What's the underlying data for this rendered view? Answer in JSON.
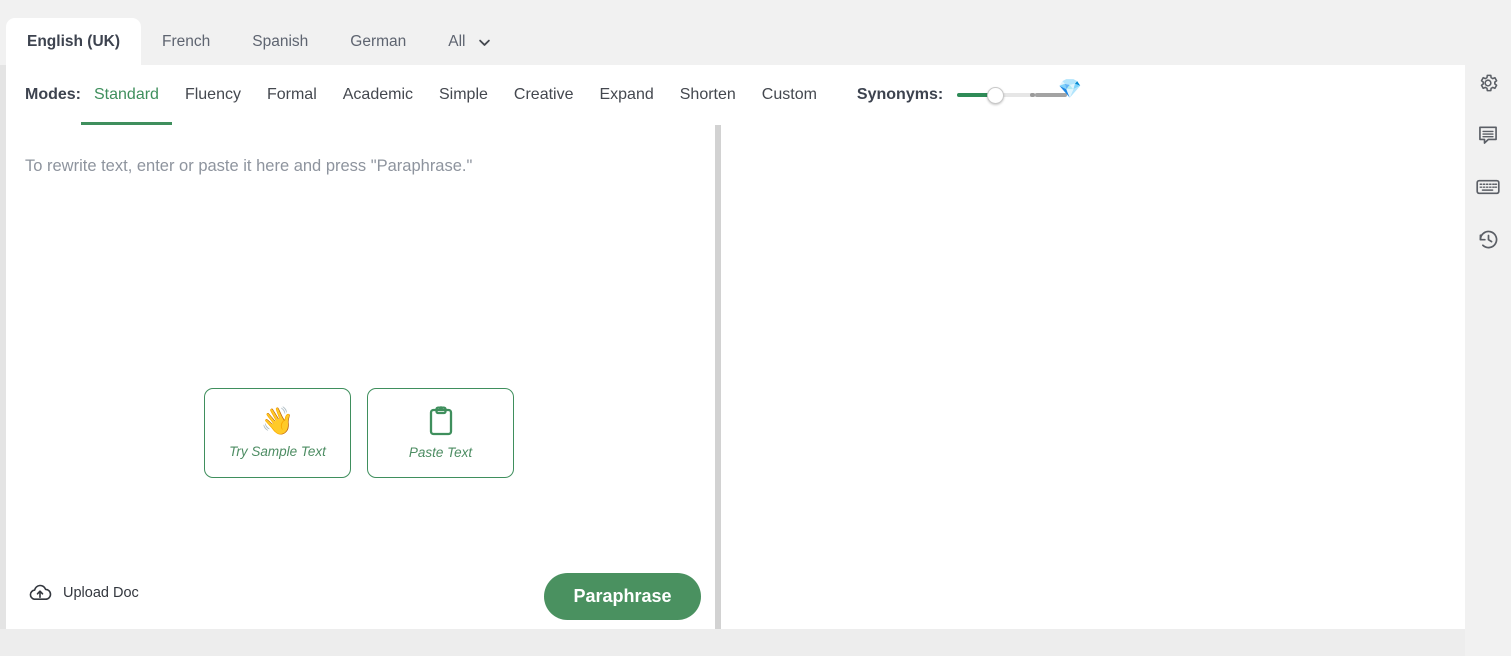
{
  "language_tabs": {
    "items": [
      {
        "label": "English (UK)",
        "active": true
      },
      {
        "label": "French",
        "active": false
      },
      {
        "label": "Spanish",
        "active": false
      },
      {
        "label": "German",
        "active": false
      },
      {
        "label": "All",
        "active": false
      }
    ],
    "dropdown_icon": "chevron-down-icon"
  },
  "modes": {
    "label": "Modes:",
    "items": [
      {
        "label": "Standard",
        "active": true
      },
      {
        "label": "Fluency",
        "active": false
      },
      {
        "label": "Formal",
        "active": false
      },
      {
        "label": "Academic",
        "active": false
      },
      {
        "label": "Simple",
        "active": false
      },
      {
        "label": "Creative",
        "active": false
      },
      {
        "label": "Expand",
        "active": false
      },
      {
        "label": "Shorten",
        "active": false
      },
      {
        "label": "Custom",
        "active": false
      }
    ],
    "active_underline_color": "#3f8f5d"
  },
  "synonyms": {
    "label": "Synonyms:",
    "value_percent": 28,
    "fill_color": "#2e8b57",
    "premium_icon": "💎"
  },
  "editor": {
    "placeholder": "To rewrite text, enter or paste it here and press \"Paraphrase.\"",
    "value": "",
    "quick_actions": [
      {
        "label": "Try Sample Text",
        "icon": "waving-hand-icon",
        "emoji": "👋"
      },
      {
        "label": "Paste Text",
        "icon": "clipboard-icon",
        "emoji": ""
      }
    ]
  },
  "bottom_bar": {
    "upload_label": "Upload Doc",
    "upload_icon": "cloud-upload-icon",
    "paraphrase_label": "Paraphrase",
    "paraphrase_color": "#4a9160"
  },
  "output_panel": {
    "content": ""
  },
  "rail": {
    "icons": [
      {
        "name": "gear-icon",
        "label": "Settings"
      },
      {
        "name": "comment-icon",
        "label": "Feedback"
      },
      {
        "name": "keyboard-icon",
        "label": "Keyboard shortcuts"
      },
      {
        "name": "history-icon",
        "label": "History"
      }
    ]
  }
}
